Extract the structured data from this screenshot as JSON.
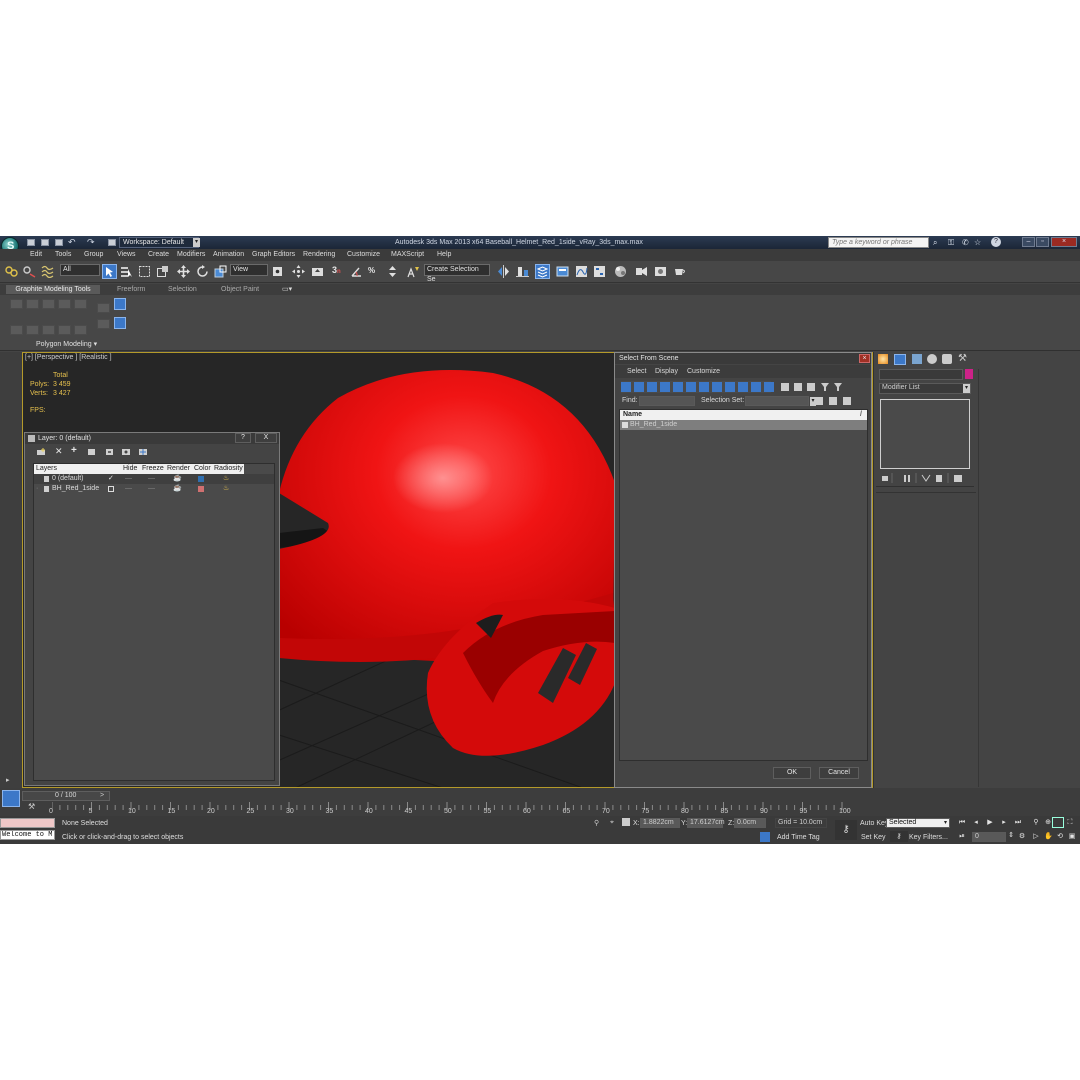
{
  "window": {
    "workspace_label": "Workspace: Default",
    "title": "Autodesk 3ds Max  2013 x64      Baseball_Helmet_Red_1side_vRay_3ds_max.max",
    "search_placeholder": "Type a keyword or phrase"
  },
  "menu": [
    "Edit",
    "Tools",
    "Group",
    "Views",
    "Create",
    "Modifiers",
    "Animation",
    "Graph Editors",
    "Rendering",
    "Customize",
    "MAXScript",
    "Help"
  ],
  "toolbar": {
    "selection_filter": "All",
    "reference_coord": "View",
    "named_selection": "Create Selection Se",
    "snap_label": "3"
  },
  "ribbon": {
    "tabs": [
      "Graphite Modeling Tools",
      "Freeform",
      "Selection",
      "Object Paint"
    ],
    "panel_label": "Polygon Modeling"
  },
  "viewport": {
    "label": "[+] [Perspective ] [Realistic ]",
    "stats_header": "Total",
    "polys_label": "Polys:",
    "polys_value": "3 459",
    "verts_label": "Verts:",
    "verts_value": "3 427",
    "fps_label": "FPS:"
  },
  "layer_dialog": {
    "title": "Layer: 0 (default)",
    "help": "?",
    "close": "X",
    "columns": [
      "Layers",
      "Hide",
      "Freeze",
      "Render",
      "Color",
      "Radiosity"
    ],
    "rows": [
      {
        "name": "0 (default)",
        "hide": "✓",
        "freeze": "—",
        "color": "#2f6fb0"
      },
      {
        "name": "BH_Red_1side",
        "hide": "",
        "freeze": "—",
        "color": "#d07070"
      }
    ]
  },
  "select_dialog": {
    "title": "Select From Scene",
    "menu": [
      "Select",
      "Display",
      "Customize"
    ],
    "find_label": "Find:",
    "selection_set_label": "Selection Set:",
    "column_name": "Name",
    "items": [
      "BH_Red_1side"
    ],
    "ok": "OK",
    "cancel": "Cancel"
  },
  "command_panel": {
    "modifier_list": "Modifier List",
    "swatch_color": "#cc2288"
  },
  "timeline": {
    "frame_label": "0 / 100",
    "ticks": [
      "0",
      "5",
      "10",
      "15",
      "20",
      "25",
      "30",
      "35",
      "40",
      "45",
      "50",
      "55",
      "60",
      "65",
      "70",
      "75",
      "80",
      "85",
      "90",
      "95",
      "100"
    ]
  },
  "status": {
    "listener": "Welcome to M",
    "selection": "None Selected",
    "prompt": "Click or click-and-drag to select objects",
    "x_label": "X:",
    "x_value": "1.8822cm",
    "y_label": "Y:",
    "y_value": "17.6127cm",
    "z_label": "Z:",
    "z_value": "0.0cm",
    "grid": "Grid = 10.0cm",
    "add_time_tag": "Add Time Tag",
    "auto_key": "Auto Key",
    "auto_key_mode": "Selected",
    "set_key": "Set Key",
    "key_filters": "Key Filters...",
    "frame": "0"
  },
  "colors": {
    "helmet": "#e00d0d",
    "viewport_border": "#b49a2a",
    "stats": "#e6c14e",
    "selected_tool": "#3c78c8"
  }
}
